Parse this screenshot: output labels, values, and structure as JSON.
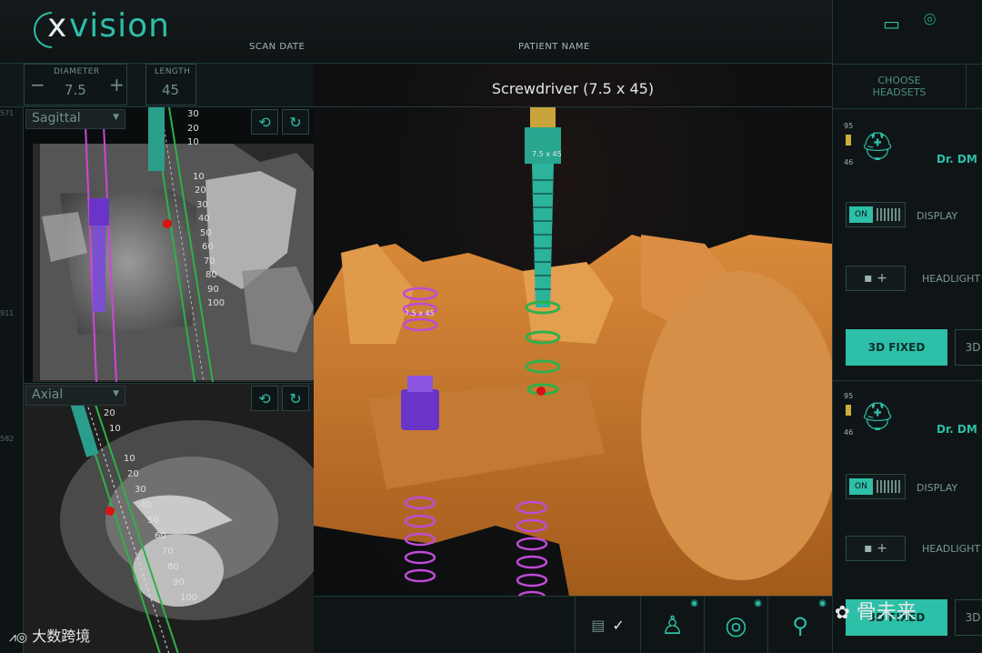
{
  "header": {
    "logo_text": "vision",
    "logo_x": "x",
    "scan_date_label": "SCAN DATE",
    "patient_name_label": "PATIENT NAME"
  },
  "controls": {
    "diameter_label": "DIAMETER",
    "diameter_value": "7.5",
    "length_label": "LENGTH",
    "length_value": "45",
    "minus": "−",
    "plus": "+"
  },
  "sagittal": {
    "view_label": "Sagittal",
    "ticks": [
      "30",
      "20",
      "10",
      "10",
      "20",
      "30",
      "40",
      "50",
      "60",
      "70",
      "80",
      "90",
      "100"
    ],
    "side_num_top": "571",
    "side_num_mid": "911"
  },
  "axial": {
    "view_label": "Axial",
    "ticks": [
      "20",
      "10",
      "10",
      "20",
      "30",
      "40",
      "50",
      "60",
      "70",
      "80",
      "90",
      "100"
    ],
    "side_num": "582"
  },
  "center": {
    "title": "Screwdriver (7.5 x 45)",
    "tool_label": "7.5 x 45",
    "implant_label": "7.5 x 45"
  },
  "right": {
    "choose_headsets": "CHOOSE HEADSETS",
    "headsets": [
      {
        "battery_top": "95",
        "battery_bottom": "46",
        "name": "Dr. DM",
        "toggle_on": "ON",
        "display_label": "DISPLAY",
        "headlight_label": "HEADLIGHT",
        "mode_active": "3D FIXED",
        "mode_other": "3D"
      },
      {
        "battery_top": "95",
        "battery_bottom": "46",
        "name": "Dr. DM",
        "toggle_on": "ON",
        "display_label": "DISPLAY",
        "headlight_label": "HEADLIGHT",
        "mode_active": "3D FIXED",
        "mode_other": "3D"
      }
    ]
  },
  "watermarks": {
    "bottom_left": "大数跨境",
    "bottom_right": "骨未来"
  },
  "colors": {
    "accent": "#2dbfa8",
    "bone": "#c9782a",
    "implant_purple": "#6b34c9",
    "ring_magenta": "#c04bd8",
    "ring_green": "#2fb04a"
  }
}
